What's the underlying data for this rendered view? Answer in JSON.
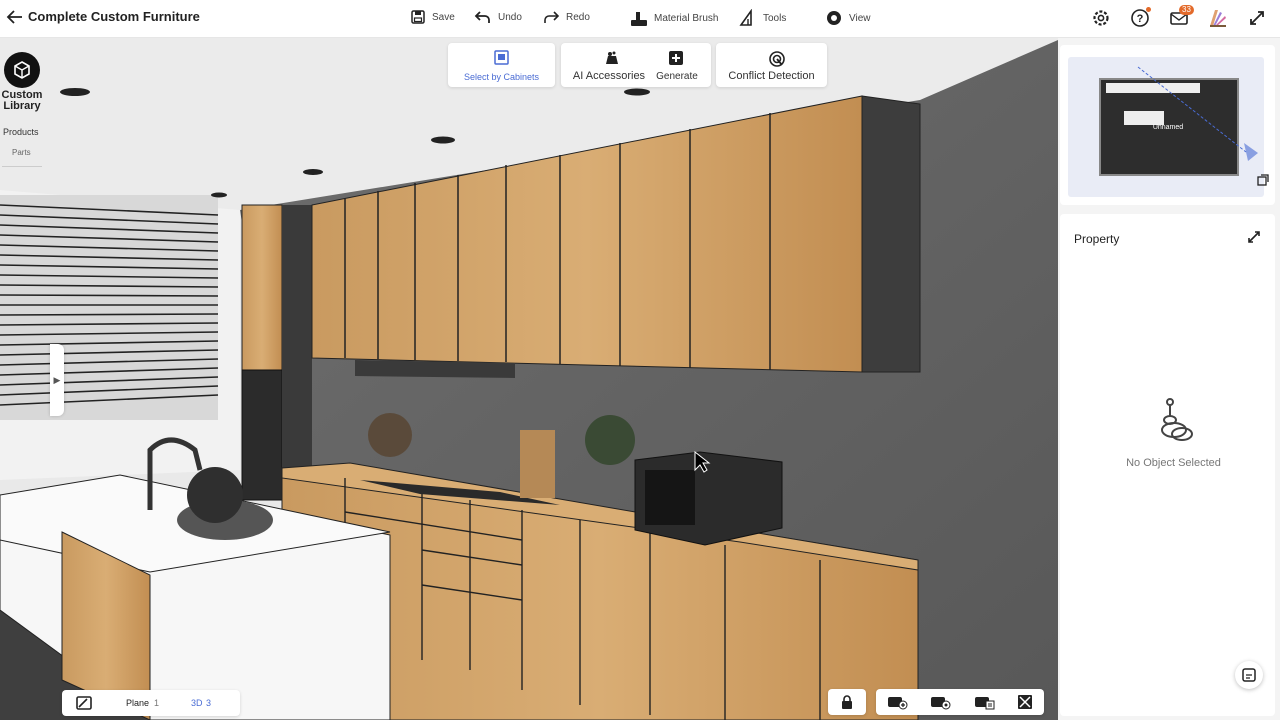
{
  "app": {
    "title": "Complete Custom Furniture"
  },
  "toolbar": {
    "save": "Save",
    "undo": "Undo",
    "redo": "Redo",
    "material_brush": "Material Brush",
    "tools": "Tools",
    "view": "View"
  },
  "header_right": {
    "mail_badge": "33"
  },
  "library": {
    "title_line1": "Custom",
    "title_line2": "Library",
    "products": "Products",
    "parts": "Parts"
  },
  "tool_cards": {
    "select_by_cabinets": "Select by Cabinets",
    "ai_accessories": "AI Accessories",
    "generate": "Generate",
    "conflict_detection": "Conflict Detection"
  },
  "minimap": {
    "room_label": "Unnamed"
  },
  "property": {
    "title": "Property",
    "empty": "No Object Selected"
  },
  "bottom": {
    "plane_label": "Plane",
    "plane_value": "1",
    "view_label": "3D",
    "view_value": "3"
  }
}
